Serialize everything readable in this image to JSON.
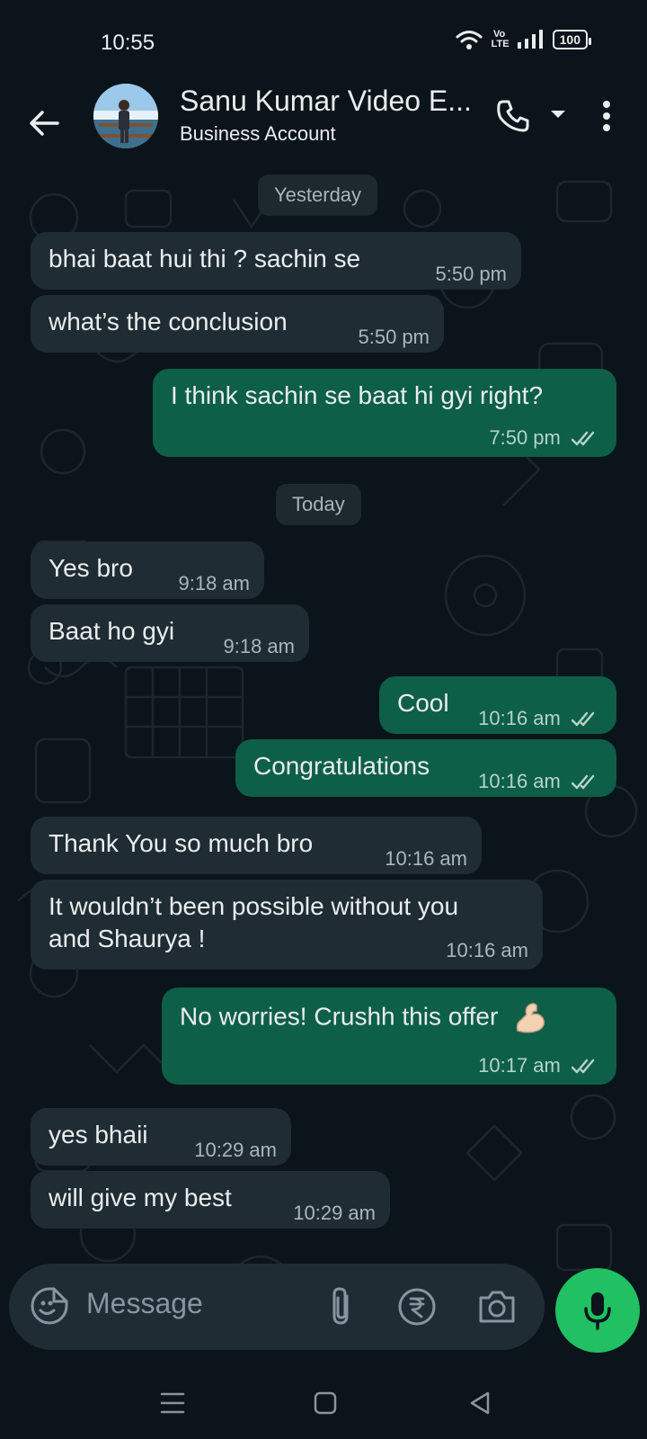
{
  "status_bar": {
    "time": "10:55",
    "volte_top": "Vo",
    "volte_bottom": "LTE",
    "battery": "100"
  },
  "header": {
    "title": "Sanu Kumar Video E...",
    "subtitle": "Business Account"
  },
  "date_chips": [
    "Yesterday",
    "Today"
  ],
  "messages": [
    {
      "direction": "in",
      "text": "bhai baat hui thi ? sachin se",
      "time": "5:50 pm"
    },
    {
      "direction": "in",
      "text": "what’s the conclusion",
      "time": "5:50 pm"
    },
    {
      "direction": "out",
      "text": "I think sachin se baat hi gyi right?",
      "time": "7:50 pm",
      "status": "read"
    },
    {
      "direction": "in",
      "text": "Yes bro",
      "time": "9:18 am"
    },
    {
      "direction": "in",
      "text": "Baat ho gyi",
      "time": "9:18 am"
    },
    {
      "direction": "out",
      "text": "Cool",
      "time": "10:16 am",
      "status": "read"
    },
    {
      "direction": "out",
      "text": "Congratulations",
      "time": "10:16 am",
      "status": "read"
    },
    {
      "direction": "in",
      "text": "Thank You so much bro",
      "time": "10:16 am"
    },
    {
      "direction": "in",
      "text_line1": "It wouldn’t been possible without you",
      "text_line2": "and Shaurya !",
      "time": "10:16 am"
    },
    {
      "direction": "out",
      "text": "No worries! Crushh this offer",
      "emoji": "flexed-biceps",
      "time": "10:17 am",
      "status": "read"
    },
    {
      "direction": "in",
      "text": "yes bhaii",
      "time": "10:29 am"
    },
    {
      "direction": "in",
      "text": "will give my best",
      "time": "10:29 am"
    }
  ],
  "composer": {
    "placeholder": "Message"
  },
  "colors": {
    "background": "#0b141a",
    "incoming_bubble": "#202c33",
    "outgoing_bubble": "#0d5f47",
    "accent_green": "#21c063",
    "tick_read": "#b6d2c8"
  },
  "icons": [
    "back-arrow-icon",
    "phone-icon",
    "caret-down-icon",
    "more-vert-icon",
    "emoji-icon",
    "paperclip-icon",
    "rupee-icon",
    "camera-icon",
    "mic-icon",
    "double-check-icon",
    "nav-menu-icon",
    "nav-home-icon",
    "nav-back-icon"
  ]
}
